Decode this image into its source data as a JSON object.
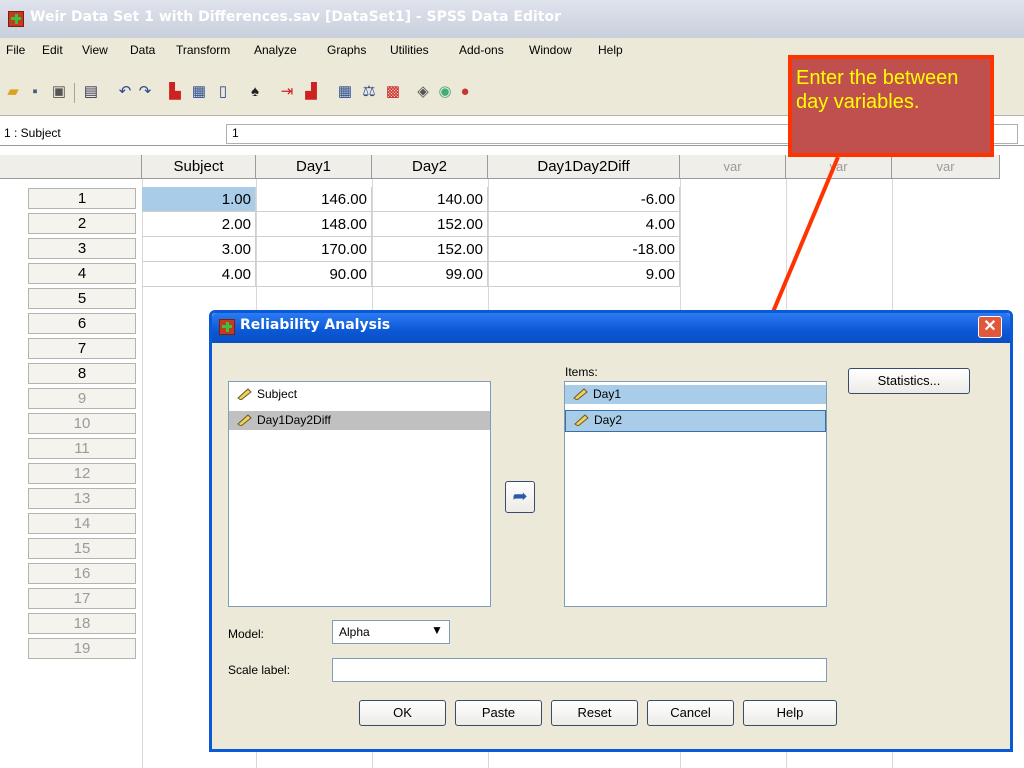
{
  "window": {
    "title": "Weir Data Set 1 with Differences.sav [DataSet1] - SPSS Data Editor"
  },
  "menu": [
    "File",
    "Edit",
    "View",
    "Data",
    "Transform",
    "Analyze",
    "Graphs",
    "Utilities",
    "Add-ons",
    "Window",
    "Help"
  ],
  "cell_editor": {
    "reference": "1 : Subject",
    "value": "1"
  },
  "grid": {
    "columns": [
      "Subject",
      "Day1",
      "Day2",
      "Day1Day2Diff",
      "var",
      "var",
      "var"
    ],
    "rows": [
      [
        "1.00",
        "146.00",
        "140.00",
        "-6.00"
      ],
      [
        "2.00",
        "148.00",
        "152.00",
        "4.00"
      ],
      [
        "3.00",
        "170.00",
        "152.00",
        "-18.00"
      ],
      [
        "4.00",
        "90.00",
        "99.00",
        "9.00"
      ]
    ],
    "row_numbers": [
      "1",
      "2",
      "3",
      "4",
      "5",
      "6",
      "7",
      "8",
      "9",
      "10",
      "11",
      "12",
      "13",
      "14",
      "15",
      "16",
      "17",
      "18",
      "19"
    ]
  },
  "callout": {
    "text": "Enter the between day variables.",
    "fill": "#c0504d",
    "border": "#ff3300",
    "text_color": "#ffff00"
  },
  "dialog": {
    "title": "Reliability Analysis",
    "source_variables": [
      "Subject",
      "Day1Day2Diff"
    ],
    "items_label": "Items:",
    "items": [
      "Day1",
      "Day2"
    ],
    "statistics_button": "Statistics...",
    "model_label": "Model:",
    "model_value": "Alpha",
    "scale_label": "Scale label:",
    "scale_value": "",
    "buttons": [
      "OK",
      "Paste",
      "Reset",
      "Cancel",
      "Help"
    ]
  },
  "icons": {
    "app": "spss-app-icon",
    "move": "arrow-left-icon",
    "variable": "ruler-icon"
  }
}
